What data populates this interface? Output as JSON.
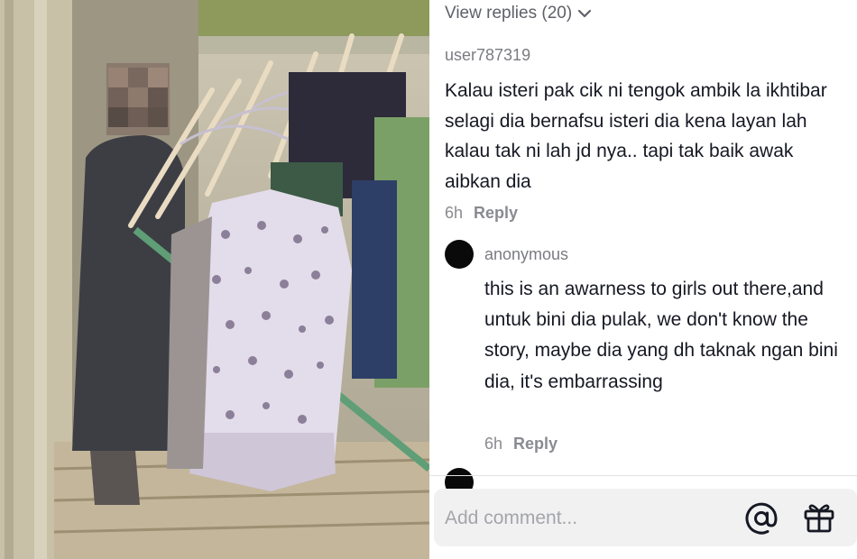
{
  "photo": {
    "alt_subject": "photo"
  },
  "comments": {
    "view_replies_label": "View replies (20)",
    "main_comment": {
      "username": "user787319",
      "text": "Kalau isteri pak cik ni tengok ambik la ikhtibar selagi dia bernafsu isteri dia kena layan lah kalau tak ni lah jd nya.. tapi tak baik awak aibkan dia",
      "time": "6h",
      "reply_label": "Reply"
    },
    "reply_comment": {
      "username": "anonymous",
      "text": "this is an awarness to girls out there,and untuk bini dia pulak, we don't know the story, maybe dia yang dh taknak ngan bini dia, it's embarrassing",
      "time": "6h",
      "reply_label": "Reply"
    }
  },
  "input": {
    "placeholder": "Add comment..."
  },
  "icons": {
    "chevron": "chevron-down-icon",
    "mention": "at-icon",
    "gift": "gift-icon"
  },
  "colors": {
    "avatar": "#0a0a0a",
    "secondary_text": "#8a8b91",
    "input_bg": "#f1f1f2"
  }
}
